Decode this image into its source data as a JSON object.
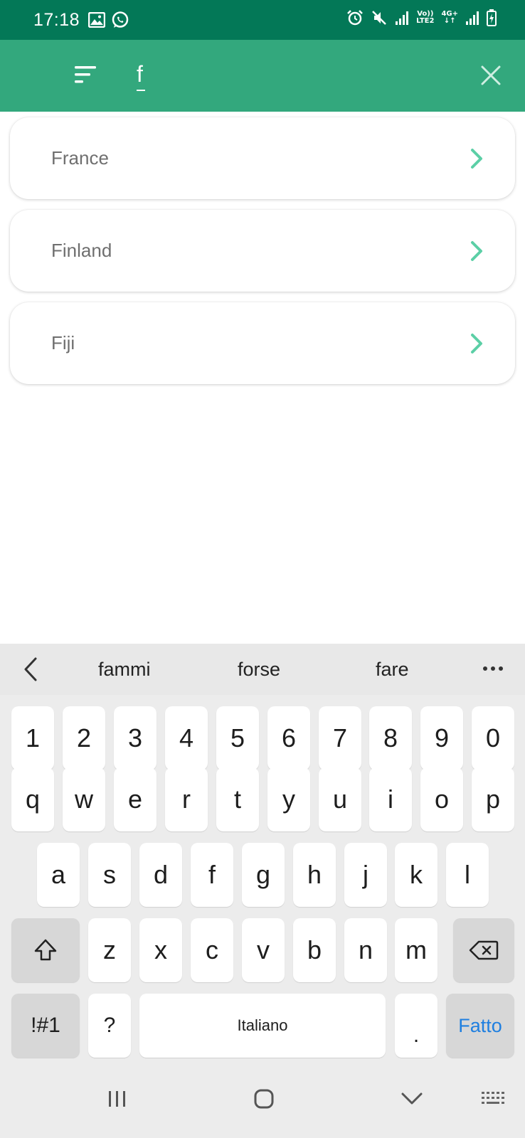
{
  "status_bar": {
    "time": "17:18",
    "network_vo": "Vo))",
    "network_lte": "LTE2",
    "network_4g": "4G+"
  },
  "search": {
    "value": "f",
    "placeholder": ""
  },
  "results": [
    {
      "label": "France"
    },
    {
      "label": "Finland"
    },
    {
      "label": "Fiji"
    }
  ],
  "keyboard": {
    "suggestions": [
      "fammi",
      "forse",
      "fare"
    ],
    "row_numbers": [
      "1",
      "2",
      "3",
      "4",
      "5",
      "6",
      "7",
      "8",
      "9",
      "0"
    ],
    "row_1": [
      "q",
      "w",
      "e",
      "r",
      "t",
      "y",
      "u",
      "i",
      "o",
      "p"
    ],
    "row_2": [
      "a",
      "s",
      "d",
      "f",
      "g",
      "h",
      "j",
      "k",
      "l"
    ],
    "row_3": [
      "z",
      "x",
      "c",
      "v",
      "b",
      "n",
      "m"
    ],
    "symbols_key": "!#1",
    "question_key": "?",
    "space_key": "Italiano",
    "period_key": ".",
    "done_key": "Fatto"
  },
  "colors": {
    "status_bar": "#037857",
    "app_bar": "#33a87d",
    "chevron": "#5ccfa6",
    "done_text": "#1f7fe0"
  },
  "icons": {
    "menu": "sort-menu-icon",
    "close": "close-icon",
    "chevron": "chevron-right-icon",
    "back": "chevron-left-icon",
    "more": "more-horizontal-icon",
    "shift": "shift-icon",
    "backspace": "backspace-icon",
    "nav_recents": "recents-icon",
    "nav_home": "home-icon",
    "nav_back": "chevron-down-icon",
    "nav_keyboard": "keyboard-icon"
  }
}
